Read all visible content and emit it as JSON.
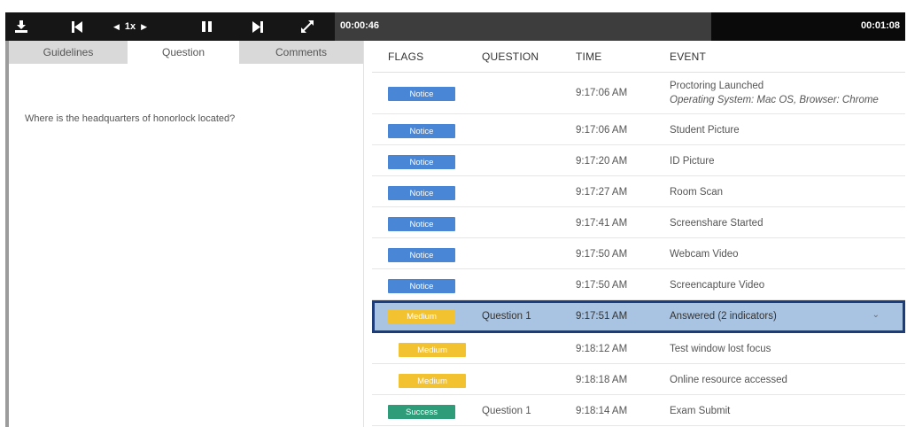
{
  "player": {
    "speed_label": "1x",
    "current_time": "00:00:46",
    "end_time": "00:01:08",
    "progress_fraction": 0.66
  },
  "tabs": [
    {
      "label": "Guidelines",
      "active": false
    },
    {
      "label": "Question",
      "active": true
    },
    {
      "label": "Comments",
      "active": false
    }
  ],
  "question": {
    "text": "Where is the headquarters of honorlock located?"
  },
  "table": {
    "columns": [
      "FLAGS",
      "QUESTION",
      "TIME",
      "EVENT"
    ],
    "rows": [
      {
        "flag": "Notice",
        "flag_type": "notice",
        "question": "",
        "time": "9:17:06 AM",
        "event": "Proctoring Launched",
        "event_sub": "Operating System: Mac OS, Browser: Chrome"
      },
      {
        "flag": "Notice",
        "flag_type": "notice",
        "question": "",
        "time": "9:17:06 AM",
        "event": "Student Picture"
      },
      {
        "flag": "Notice",
        "flag_type": "notice",
        "question": "",
        "time": "9:17:20 AM",
        "event": "ID Picture"
      },
      {
        "flag": "Notice",
        "flag_type": "notice",
        "question": "",
        "time": "9:17:27 AM",
        "event": "Room Scan"
      },
      {
        "flag": "Notice",
        "flag_type": "notice",
        "question": "",
        "time": "9:17:41 AM",
        "event": "Screenshare Started"
      },
      {
        "flag": "Notice",
        "flag_type": "notice",
        "question": "",
        "time": "9:17:50 AM",
        "event": "Webcam Video"
      },
      {
        "flag": "Notice",
        "flag_type": "notice",
        "question": "",
        "time": "9:17:50 AM",
        "event": "Screencapture Video"
      },
      {
        "flag": "Medium",
        "flag_type": "medium",
        "question": "Question 1",
        "time": "9:17:51 AM",
        "event": "Answered (2 indicators)",
        "selected": true
      },
      {
        "flag": "Medium",
        "flag_type": "medium",
        "question": "",
        "time": "9:18:12 AM",
        "event": "Test window lost focus",
        "indented": true
      },
      {
        "flag": "Medium",
        "flag_type": "medium",
        "question": "",
        "time": "9:18:18 AM",
        "event": "Online resource accessed",
        "indented": true
      },
      {
        "flag": "Success",
        "flag_type": "success",
        "question": "Question 1",
        "time": "9:18:14 AM",
        "event": "Exam Submit"
      }
    ]
  },
  "colors": {
    "notice": "#4a86d6",
    "medium": "#f2c230",
    "success": "#2e9b79",
    "selected_row": "#a8c4e2",
    "selected_border": "#1c3c7a"
  }
}
